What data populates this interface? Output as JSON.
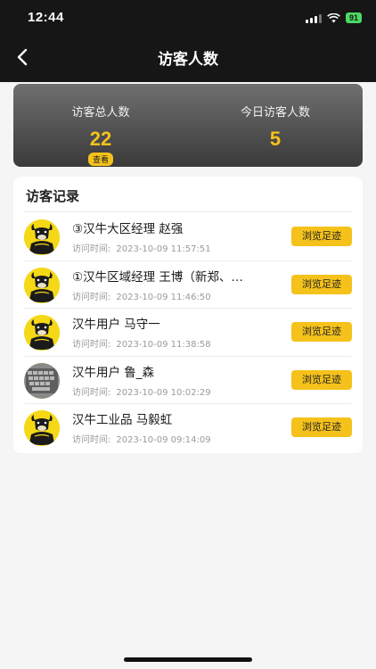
{
  "status_bar": {
    "time": "12:44",
    "battery": "91",
    "icons": [
      "signal-icon",
      "wifi-icon",
      "battery-icon"
    ]
  },
  "nav": {
    "title": "访客人数",
    "back_icon": "chevron-left-icon"
  },
  "stats": {
    "total_label": "访客总人数",
    "total_value": "22",
    "view_label": "查看",
    "today_label": "今日访客人数",
    "today_value": "5"
  },
  "records": {
    "title": "访客记录",
    "time_label": "访问时间:",
    "button_label": "浏览足迹",
    "items": [
      {
        "name": "③汉牛大区经理 赵强",
        "time": "2023-10-09 11:57:51",
        "avatar": "bull-logo"
      },
      {
        "name": "①汉牛区域经理 王博（新郑、…",
        "time": "2023-10-09 11:46:50",
        "avatar": "bull-logo"
      },
      {
        "name": "汉牛用户 马守一",
        "time": "2023-10-09 11:38:58",
        "avatar": "bull-logo"
      },
      {
        "name": "汉牛用户 鲁_森",
        "time": "2023-10-09 10:02:29",
        "avatar": "keyboard-photo"
      },
      {
        "name": "汉牛工业品 马毅虹",
        "time": "2023-10-09 09:14:09",
        "avatar": "bull-logo"
      }
    ]
  },
  "colors": {
    "accent": "#f5c21b",
    "header_bg": "#161616",
    "page_bg": "#f5f5f5"
  }
}
